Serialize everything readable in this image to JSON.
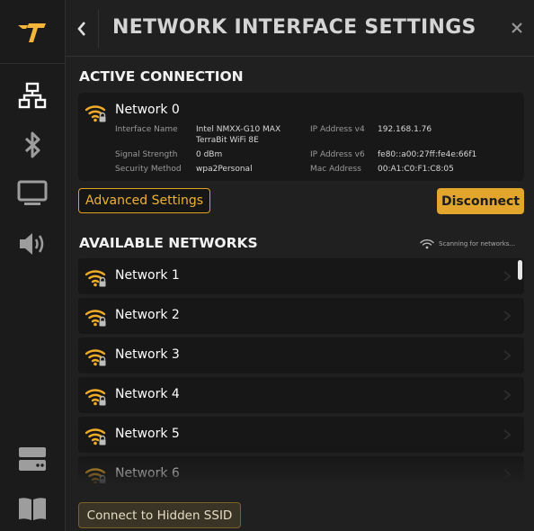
{
  "app": {
    "logo_icon": "brand-logo-icon",
    "accent": "#E1A62B"
  },
  "sidebar": {
    "items": [
      {
        "name": "network",
        "icon": "network-icon",
        "active": true
      },
      {
        "name": "bluetooth",
        "icon": "bluetooth-icon",
        "active": false
      },
      {
        "name": "display",
        "icon": "monitor-icon",
        "active": false
      },
      {
        "name": "audio",
        "icon": "speaker-icon",
        "active": false
      },
      {
        "name": "storage",
        "icon": "storage-icon",
        "active": false
      },
      {
        "name": "manual",
        "icon": "book-icon",
        "active": false
      }
    ]
  },
  "header": {
    "title": "NETWORK INTERFACE SETTINGS",
    "back_icon": "chevron-left-icon",
    "close_icon": "close-icon"
  },
  "active_connection": {
    "section_title": "ACTIVE CONNECTION",
    "network_name": "Network 0",
    "details": {
      "interface_name_label": "Interface Name",
      "interface_name_line1": "Intel NMXX-G10 MAX",
      "interface_name_line2": "TerraBit WiFi 8E",
      "signal_strength_label": "Signal Strength",
      "signal_strength": "0 dBm",
      "security_method_label": "Security Method",
      "security_method": "wpa2Personal",
      "ipv4_label": "IP Address v4",
      "ipv4": "192.168.1.76",
      "ipv6_label": "IP Address v6",
      "ipv6": "fe80::a00:27ff:fe4e:66f1",
      "mac_label": "Mac Address",
      "mac": "00:A1:C0:F1:C8:05"
    },
    "advanced_button": "Advanced Settings",
    "disconnect_button": "Disconnect"
  },
  "available_networks": {
    "section_title": "AVAILABLE NETWORKS",
    "scanning_text": "Scanning for networks...",
    "networks": [
      {
        "name": "Network 1",
        "secured": true
      },
      {
        "name": "Network 2",
        "secured": true
      },
      {
        "name": "Network 3",
        "secured": true
      },
      {
        "name": "Network 4",
        "secured": true
      },
      {
        "name": "Network 5",
        "secured": true
      },
      {
        "name": "Network 6",
        "secured": true
      }
    ]
  },
  "footer": {
    "hidden_ssid_button": "Connect to Hidden SSID"
  }
}
